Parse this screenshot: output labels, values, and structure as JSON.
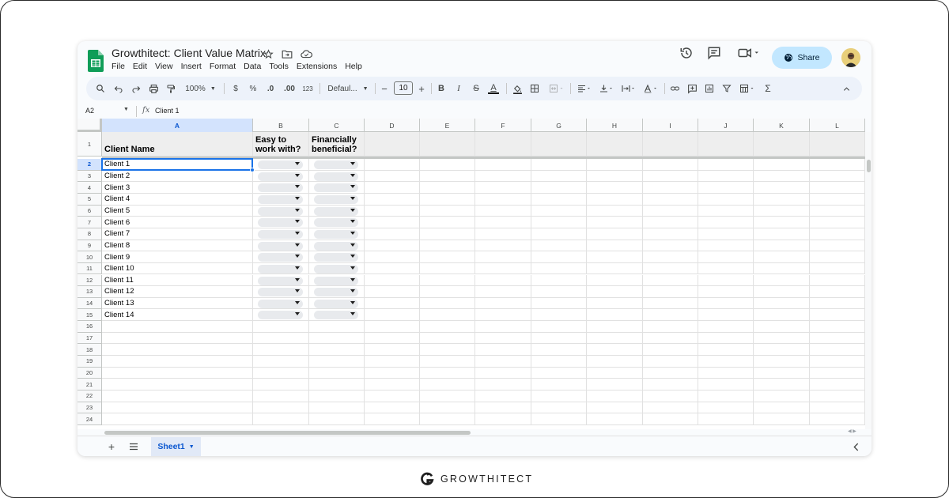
{
  "app": {
    "title": "Growthitect: Client Value Matrix",
    "menu": [
      "File",
      "Edit",
      "View",
      "Insert",
      "Format",
      "Data",
      "Tools",
      "Extensions",
      "Help"
    ],
    "share_label": "Share"
  },
  "toolbar": {
    "zoom": "100%",
    "currency": "$",
    "percent": "%",
    "decrease_decimal": ".0",
    "increase_decimal": ".00",
    "number_format": "123",
    "font": "Defaul...",
    "font_size": "10",
    "decrease_font": "−",
    "increase_font": "+",
    "bold": "B",
    "italic": "I",
    "strikethrough": "S",
    "text_color": "A",
    "function": "Σ"
  },
  "formula_bar": {
    "name_box": "A2",
    "fx": "fx",
    "value": "Client 1"
  },
  "grid": {
    "columns": [
      "A",
      "B",
      "C",
      "D",
      "E",
      "F",
      "G",
      "H",
      "I",
      "J",
      "K",
      "L"
    ],
    "selected_column": "A",
    "selected_row": "2",
    "row_numbers": [
      "1",
      "2",
      "3",
      "4",
      "5",
      "6",
      "7",
      "8",
      "9",
      "10",
      "11",
      "12",
      "13",
      "14",
      "15",
      "16",
      "17",
      "18",
      "19",
      "20",
      "21",
      "22",
      "23",
      "24"
    ],
    "headers": {
      "a": "Client Name",
      "b": "Easy to work with?",
      "c": "Financially beneficial?"
    },
    "clients": [
      "Client 1",
      "Client 2",
      "Client 3",
      "Client 4",
      "Client 5",
      "Client 6",
      "Client 7",
      "Client 8",
      "Client 9",
      "Client 10",
      "Client 11",
      "Client 12",
      "Client 13",
      "Client 14"
    ]
  },
  "sheet_tabs": {
    "active": "Sheet1"
  },
  "footer": {
    "brand": "GROWTHITECT"
  },
  "colors": {
    "accent": "#1a73e8",
    "share_bg": "#c2e7ff",
    "sheets_green": "#0f9d58",
    "header_fill": "#eeeeee"
  },
  "icons": [
    "sheets-logo-icon",
    "star-icon",
    "move-folder-icon",
    "cloud-saved-icon",
    "history-icon",
    "comment-icon",
    "video-call-icon",
    "globe-icon",
    "search-icon",
    "undo-icon",
    "redo-icon",
    "print-icon",
    "paint-format-icon",
    "fill-color-icon",
    "borders-icon",
    "merge-icon",
    "align-icon",
    "valign-icon",
    "wrap-icon",
    "rotate-icon",
    "link-icon",
    "insert-comment-icon",
    "insert-chart-icon",
    "filter-icon",
    "filter-views-icon",
    "collapse-toolbar-icon",
    "add-sheet-icon",
    "all-sheets-icon",
    "brand-logo-icon"
  ]
}
